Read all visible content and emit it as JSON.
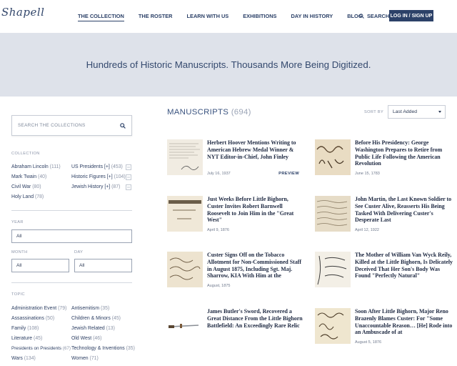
{
  "nav": {
    "logo": "Shapell",
    "links": [
      "THE COLLECTION",
      "THE ROSTER",
      "LEARN WITH US",
      "EXHIBITIONS",
      "DAY IN HISTORY",
      "BLOG"
    ],
    "search_label": "SEARCH",
    "login_label": "LOG IN / SIGN UP"
  },
  "hero": {
    "text": "Hundreds of Historic Manuscripts. Thousands More Being Digitized."
  },
  "sidebar": {
    "search_placeholder": "SEARCH THE COLLECTIONS",
    "collection_label": "COLLECTION",
    "collection_items": [
      {
        "label": "Abraham Lincoln",
        "count": "(111)"
      },
      {
        "label": "US Presidents [+]",
        "count": "(453)"
      },
      {
        "label": "Mark Twain",
        "count": "(40)"
      },
      {
        "label": "Historic Figures [+]",
        "count": "(104)"
      },
      {
        "label": "Civil War",
        "count": "(80)"
      },
      {
        "label": "Jewish History [+]",
        "count": "(87)"
      },
      {
        "label": "Holy Land",
        "count": "(78)"
      }
    ],
    "year_label": "YEAR",
    "year_value": "All",
    "month_label": "MONTH",
    "month_value": "All",
    "day_label": "DAY",
    "day_value": "All",
    "topic_label": "TOPIC",
    "topic_items": [
      {
        "label": "Administration Event",
        "count": "(79)"
      },
      {
        "label": "Antisemitism",
        "count": "(35)"
      },
      {
        "label": "Assassinations",
        "count": "(50)"
      },
      {
        "label": "Children & Minors",
        "count": "(45)"
      },
      {
        "label": "Family",
        "count": "(108)"
      },
      {
        "label": "Jewish Related",
        "count": "(13)"
      },
      {
        "label": "Literature",
        "count": "(45)"
      },
      {
        "label": "Old West",
        "count": "(46)"
      },
      {
        "label": "Presidents on Presidents",
        "count": "(67)"
      },
      {
        "label": "Technology & Inventions",
        "count": "(35)"
      },
      {
        "label": "Wars",
        "count": "(134)"
      },
      {
        "label": "Women",
        "count": "(71)"
      }
    ]
  },
  "main": {
    "title": "MANUSCRIPTS",
    "count": "(694)",
    "sort_label": "SORT BY",
    "sort_value": "Last Added",
    "preview_label": "PREVIEW",
    "cards": [
      {
        "title": "Herbert Hoover Mentions Writing to American Hebrew Medal Winner & NYT Editor-in-Chief, John Finley",
        "date": "July 16, 1937"
      },
      {
        "title": "Before His Presidency: George Washington Prepares to Retire from Public Life Following the American Revolution",
        "date": "June 15, 1783"
      },
      {
        "title": "Just Weeks Before Little Bighorn, Custer Invites Robert Barnwell Roosevelt to Join Him in the \"Great West\"",
        "date": "April 9, 1876"
      },
      {
        "title": "John Martin, the Last Known Soldier to See Custer Alive, Reasserts His Being Tasked With Delivering Custer's Desperate Last",
        "date": "April 12, 1922"
      },
      {
        "title": "Custer Signs Off on the Tobacco Allotment for Non-Commissioned Staff in August 1875, Including Sgt. Maj. Sharrow, KIA With Him at the",
        "date": "August, 1875"
      },
      {
        "title": "The Mother of William Van Wyck Reily, Killed at the Little Bighorn, Is Delicately Deceived That Her Son's Body Was Found \"Perfectly Natural\"",
        "date": ""
      },
      {
        "title": "James Butler's Sword, Recovered a Great Distance From the Little Bighorn Battlefield: An Exceedingly Rare Relic",
        "date": ""
      },
      {
        "title": "Soon After Little Bighorn, Major Reno Brazenly Blames Custer: For \"Some Unaccountable Reason… [He] Rode into an Ambuscade of at",
        "date": "August 5, 1876"
      }
    ]
  }
}
